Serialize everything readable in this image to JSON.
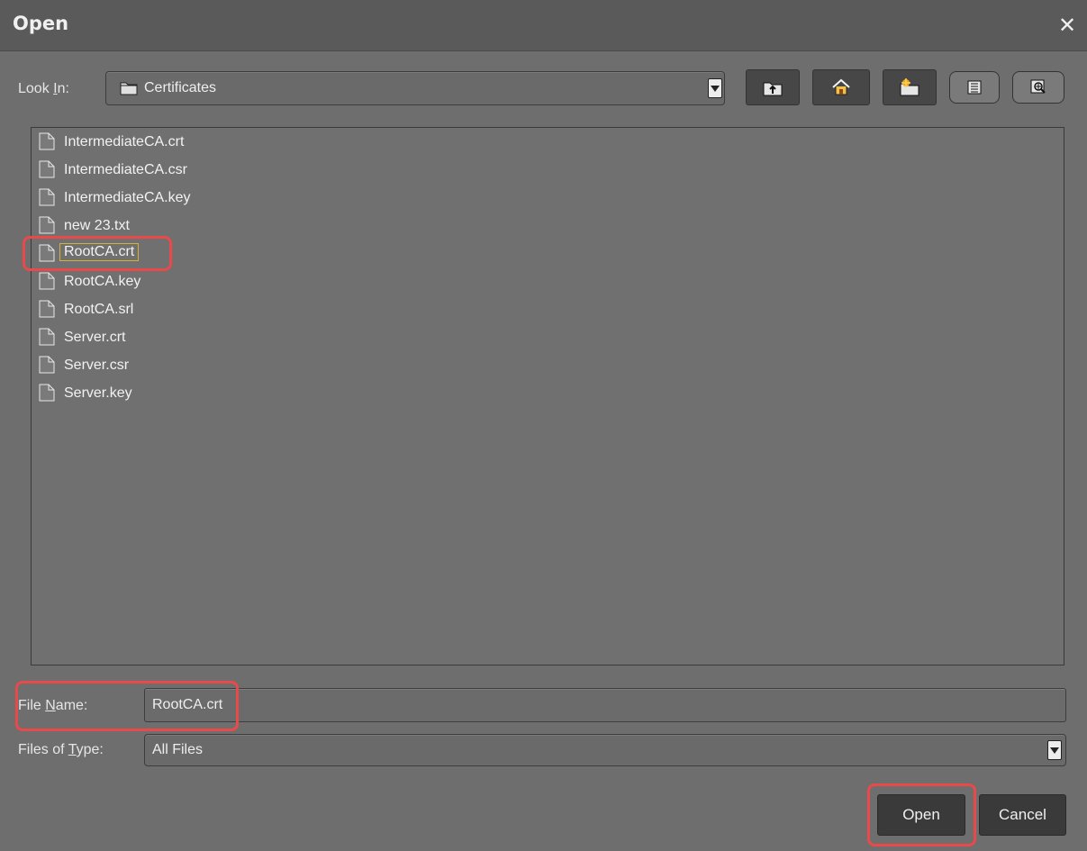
{
  "dialog": {
    "title": "Open",
    "close_glyph": "✕"
  },
  "look_in": {
    "label_pre": "Look ",
    "label_u": "I",
    "label_post": "n:",
    "value": "Certificates",
    "toolbar": [
      "up-folder-icon",
      "home-icon",
      "new-folder-icon",
      "list-view-icon",
      "details-view-icon"
    ]
  },
  "files": [
    {
      "name": "IntermediateCA.crt"
    },
    {
      "name": "IntermediateCA.csr"
    },
    {
      "name": "IntermediateCA.key"
    },
    {
      "name": "new 23.txt"
    },
    {
      "name": "RootCA.crt"
    },
    {
      "name": "RootCA.key"
    },
    {
      "name": "RootCA.srl"
    },
    {
      "name": "Server.crt"
    },
    {
      "name": "Server.csr"
    },
    {
      "name": "Server.key"
    }
  ],
  "selected_file": "RootCA.crt",
  "file_name": {
    "label_pre": "File ",
    "label_u": "N",
    "label_post": "ame:",
    "value": "RootCA.crt"
  },
  "files_of_type": {
    "label_pre": "Files of ",
    "label_u": "T",
    "label_post": "ype:",
    "value": "All Files"
  },
  "buttons": {
    "open": "Open",
    "cancel": "Cancel"
  },
  "colors": {
    "highlight": "#e84a4a",
    "selection_outline": "#d4b13a"
  }
}
